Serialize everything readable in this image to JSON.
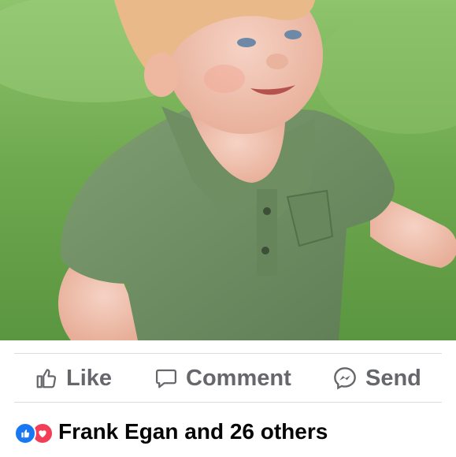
{
  "post": {
    "photo_icon": "child-photo",
    "actions": {
      "like_label": "Like",
      "comment_label": "Comment",
      "send_label": "Send"
    },
    "reactions": {
      "icons": [
        "like-reaction-icon",
        "love-reaction-icon"
      ],
      "summary": "Frank Egan and 26 others"
    }
  },
  "colors": {
    "action_text": "#65676b",
    "like_blue": "#1877f2",
    "love_red": "#f33e58",
    "divider": "#dadde1"
  }
}
